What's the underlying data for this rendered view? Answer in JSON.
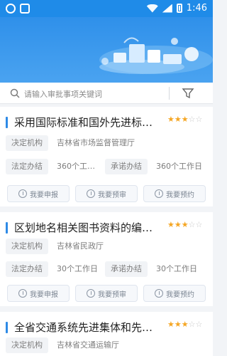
{
  "status_bar": {
    "time": "1:46"
  },
  "search": {
    "placeholder": "请输入审批事项关键词"
  },
  "labels": {
    "decision_org": "决定机构",
    "legal_time": "法定办结",
    "promise_time": "承诺办结",
    "apply": "我要申报",
    "preview": "我要预审",
    "appointment": "我要预约"
  },
  "items": [
    {
      "title": "采用国际标准和国外先进标…",
      "stars": 3,
      "organization": "吉林省市场监督管理厅",
      "legal_days": "360个工…",
      "promise_days": "360个工作日"
    },
    {
      "title": "区划地名相关图书资料的编…",
      "stars": 3,
      "organization": "吉林省民政厅",
      "legal_days": "30个工作日",
      "promise_days": "30个工作日"
    },
    {
      "title": "全省交通系统先进集体和先…",
      "stars": 3,
      "organization": "吉林省交通运输厅"
    }
  ],
  "colors": {
    "primary": "#2e8ae6",
    "star": "#f5a623",
    "background": "#f2f4f7"
  }
}
